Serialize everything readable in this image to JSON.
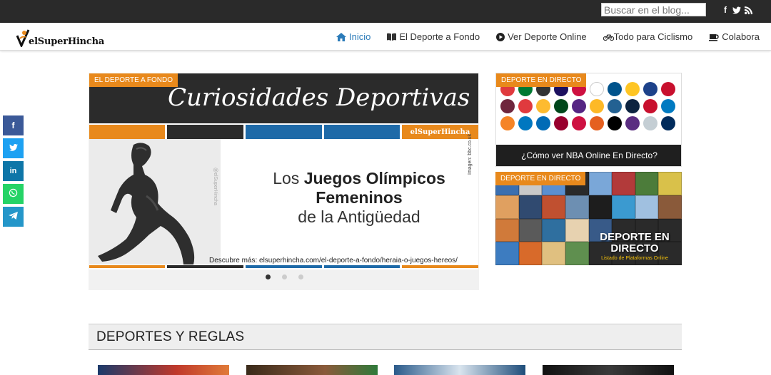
{
  "topbar": {
    "search_placeholder": "Buscar en el blog...",
    "social": [
      "facebook-icon",
      "twitter-icon",
      "rss-icon"
    ]
  },
  "navbar": {
    "logo_text": "elSuperHincha",
    "items": [
      {
        "label": "Inicio",
        "icon": "home-icon",
        "active": true
      },
      {
        "label": "El Deporte a Fondo",
        "icon": "book-icon",
        "active": false
      },
      {
        "label": "Ver Deporte Online",
        "icon": "play-circle-icon",
        "active": false
      },
      {
        "label": "Todo para Ciclismo",
        "icon": "bicycle-icon",
        "active": false
      },
      {
        "label": "Colabora",
        "icon": "coffee-icon",
        "active": false
      }
    ]
  },
  "share": [
    "facebook-icon",
    "twitter-icon",
    "linkedin-icon",
    "whatsapp-icon",
    "telegram-icon"
  ],
  "slider": {
    "tag": "EL DEPORTE A FONDO",
    "header_title": "Curiosidades Deportivas",
    "brand": "elSuperHincha",
    "text_l1_plain": "Los ",
    "text_l1_bold": "Juegos Olímpicos",
    "text_l2": "Femeninos",
    "text_l3": "de la Antigüedad",
    "url_text": "Descubre más: elsuperhincha.com/el-deporte-a-fondo/heraia-o-juegos-hereos/",
    "credit": "Imagen: bbc.co.uk",
    "watermark": "@elSuperHincha",
    "dots": 3,
    "active_dot": 0
  },
  "side_cards": [
    {
      "tag": "DEPORTE EN DIRECTO",
      "caption": "¿Cómo ver NBA Online En Directo?"
    },
    {
      "tag": "DEPORTE EN DIRECTO",
      "caption": "DEPORTE EN DIRECTO",
      "sub": "Listado de Plataformas Online"
    }
  ],
  "section": {
    "title": "DEPORTES Y REGLAS"
  },
  "colors": {
    "accent": "#e8891c",
    "blue": "#1e6aa8",
    "nav_active": "#2b7bb9",
    "topbar": "#2a2a2a"
  }
}
